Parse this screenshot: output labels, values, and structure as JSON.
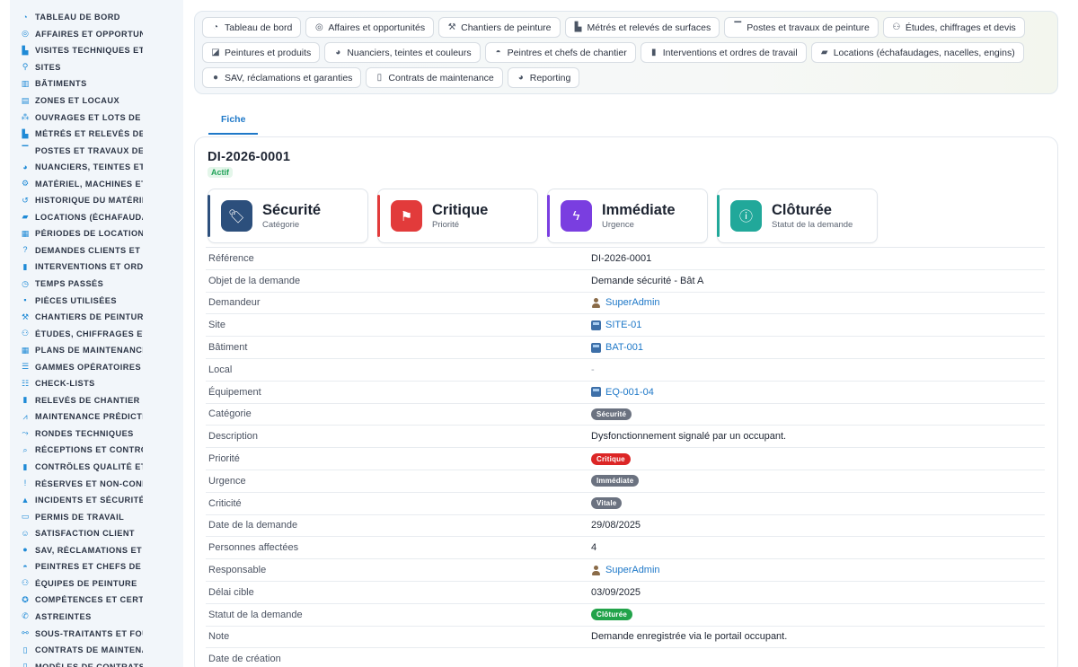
{
  "colors": {
    "accent": "#1e78c8",
    "securite": "#2c4f7c",
    "critique": "#e23b3b",
    "immediate": "#7a3ee0",
    "cloturee": "#21a89a",
    "badge_grey": "#6b7280",
    "badge_red": "#dc2626",
    "badge_green": "#22a34a"
  },
  "sidebar": {
    "items": [
      {
        "label": "TABLEAU DE BORD",
        "icon": "gauge-icon"
      },
      {
        "label": "AFFAIRES ET OPPORTUN",
        "icon": "target-icon"
      },
      {
        "label": "VISITES TECHNIQUES ET",
        "icon": "boot-icon"
      },
      {
        "label": "SITES",
        "icon": "map-pin-icon"
      },
      {
        "label": "BÂTIMENTS",
        "icon": "building-icon"
      },
      {
        "label": "ZONES ET LOCAUX",
        "icon": "layers-icon"
      },
      {
        "label": "OUVRAGES ET LOTS DE T",
        "icon": "sitemap-icon"
      },
      {
        "label": "MÉTRÉS ET RELEVÉS DE",
        "icon": "ruler-icon"
      },
      {
        "label": "POSTES ET TRAVAUX DE",
        "icon": "paint-roller-icon"
      },
      {
        "label": "NUANCIERS, TEINTES ET",
        "icon": "palette-icon"
      },
      {
        "label": "MATÉRIEL, MACHINES ET",
        "icon": "cogs-icon"
      },
      {
        "label": "HISTORIQUE DU MATÉRIE",
        "icon": "history-icon"
      },
      {
        "label": "LOCATIONS (ÉCHAFAUDA",
        "icon": "truck-icon"
      },
      {
        "label": "PÉRIODES DE LOCATION",
        "icon": "calendar-icon"
      },
      {
        "label": "DEMANDES CLIENTS ET I",
        "icon": "question-icon"
      },
      {
        "label": "INTERVENTIONS ET ORDI",
        "icon": "clipboard-icon"
      },
      {
        "label": "TEMPS PASSÉS",
        "icon": "clock-icon"
      },
      {
        "label": "PIÈCES UTILISÉES",
        "icon": "puzzle-icon"
      },
      {
        "label": "CHANTIERS DE PEINTURI",
        "icon": "hammer-icon"
      },
      {
        "label": "ÉTUDES, CHIFFRAGES ET",
        "icon": "people-icon"
      },
      {
        "label": "PLANS DE MAINTENANCE",
        "icon": "calendar-check-icon"
      },
      {
        "label": "GAMMES OPÉRATOIRES",
        "icon": "list-icon"
      },
      {
        "label": "CHECK-LISTS",
        "icon": "checklist-icon"
      },
      {
        "label": "RELEVÉS DE CHANTIER",
        "icon": "clipboard-list-icon"
      },
      {
        "label": "MAINTENANCE PRÉDICTIT",
        "icon": "chart-line-icon"
      },
      {
        "label": "RONDES TECHNIQUES",
        "icon": "route-icon"
      },
      {
        "label": "RÉCEPTIONS ET CONTRĈ",
        "icon": "search-icon"
      },
      {
        "label": "CONTRÔLES QUALITÉ ET",
        "icon": "clipboard-check-icon"
      },
      {
        "label": "RÉSERVES ET NON-CONF",
        "icon": "alert-circle-icon"
      },
      {
        "label": "INCIDENTS ET SÉCURITÉ",
        "icon": "warning-icon"
      },
      {
        "label": "PERMIS DE TRAVAIL",
        "icon": "id-card-icon"
      },
      {
        "label": "SATISFACTION CLIENT",
        "icon": "smile-icon"
      },
      {
        "label": "SAV, RÉCLAMATIONS ET (",
        "icon": "chat-icon"
      },
      {
        "label": "PEINTRES ET CHEFS DE (",
        "icon": "hard-hat-icon"
      },
      {
        "label": "ÉQUIPES DE PEINTURE",
        "icon": "team-icon"
      },
      {
        "label": "COMPÉTENCES ET CERTI",
        "icon": "certificate-icon"
      },
      {
        "label": "ASTREINTES",
        "icon": "phone-icon"
      },
      {
        "label": "SOUS-TRAITANTS ET FOU",
        "icon": "handshake-icon"
      },
      {
        "label": "CONTRATS DE MAINTENA",
        "icon": "file-contract-icon"
      },
      {
        "label": "MODÈLES DE CONTRATS",
        "icon": "file-icon"
      }
    ]
  },
  "topnav": {
    "chips": [
      {
        "label": "Tableau de bord",
        "icon": "gauge-icon"
      },
      {
        "label": "Affaires et opportunités",
        "icon": "target-icon"
      },
      {
        "label": "Chantiers de peinture",
        "icon": "hammer-icon"
      },
      {
        "label": "Métrés et relevés de surfaces",
        "icon": "ruler-icon"
      },
      {
        "label": "Postes et travaux de peinture",
        "icon": "paint-roller-icon"
      },
      {
        "label": "Études, chiffrages et devis",
        "icon": "people-icon"
      },
      {
        "label": "Peintures et produits",
        "icon": "paint-bucket-icon"
      },
      {
        "label": "Nuanciers, teintes et couleurs",
        "icon": "palette-icon"
      },
      {
        "label": "Peintres et chefs de chantier",
        "icon": "hard-hat-icon"
      },
      {
        "label": "Interventions et ordres de travail",
        "icon": "clipboard-icon"
      },
      {
        "label": "Locations (échafaudages, nacelles, engins)",
        "icon": "truck-icon"
      },
      {
        "label": "SAV, réclamations et garanties",
        "icon": "chat-icon"
      },
      {
        "label": "Contrats de maintenance",
        "icon": "file-contract-icon"
      },
      {
        "label": "Reporting",
        "icon": "pie-chart-icon"
      }
    ]
  },
  "tabs": {
    "fiche": "Fiche"
  },
  "record": {
    "title": "DI-2026-0001",
    "status_badge": "Actif",
    "kpis": [
      {
        "value": "Sécurité",
        "label": "Catégorie",
        "icon": "tag-icon",
        "color_key": "securite"
      },
      {
        "value": "Critique",
        "label": "Priorité",
        "icon": "flag-icon",
        "color_key": "critique"
      },
      {
        "value": "Immédiate",
        "label": "Urgence",
        "icon": "bolt-icon",
        "color_key": "immediate"
      },
      {
        "value": "Clôturée",
        "label": "Statut de la demande",
        "icon": "info-icon",
        "color_key": "cloturee"
      }
    ],
    "fields": [
      {
        "label": "Référence",
        "value": "DI-2026-0001",
        "kind": "text"
      },
      {
        "label": "Objet de la demande",
        "value": "Demande sécurité - Bât A",
        "kind": "text"
      },
      {
        "label": "Demandeur",
        "value": "SuperAdmin",
        "kind": "user"
      },
      {
        "label": "Site",
        "value": "SITE-01",
        "kind": "entity"
      },
      {
        "label": "Bâtiment",
        "value": "BAT-001",
        "kind": "entity"
      },
      {
        "label": "Local",
        "value": "-",
        "kind": "muted"
      },
      {
        "label": "Équipement",
        "value": "EQ-001-04",
        "kind": "entity"
      },
      {
        "label": "Catégorie",
        "value": "Sécurité",
        "kind": "pill",
        "pill_color": "badge_grey"
      },
      {
        "label": "Description",
        "value": "Dysfonctionnement signalé par un occupant.",
        "kind": "text"
      },
      {
        "label": "Priorité",
        "value": "Critique",
        "kind": "pill",
        "pill_color": "badge_red"
      },
      {
        "label": "Urgence",
        "value": "Immédiate",
        "kind": "pill",
        "pill_color": "badge_grey"
      },
      {
        "label": "Criticité",
        "value": "Vitale",
        "kind": "pill",
        "pill_color": "badge_grey"
      },
      {
        "label": "Date de la demande",
        "value": "29/08/2025",
        "kind": "text"
      },
      {
        "label": "Personnes affectées",
        "value": "4",
        "kind": "text"
      },
      {
        "label": "Responsable",
        "value": "SuperAdmin",
        "kind": "user"
      },
      {
        "label": "Délai cible",
        "value": "03/09/2025",
        "kind": "text"
      },
      {
        "label": "Statut de la demande",
        "value": "Clôturée",
        "kind": "pill",
        "pill_color": "badge_green"
      },
      {
        "label": "Note",
        "value": "Demande enregistrée via le portail occupant.",
        "kind": "text"
      },
      {
        "label": "Date de création",
        "value": "",
        "kind": "text"
      }
    ]
  }
}
